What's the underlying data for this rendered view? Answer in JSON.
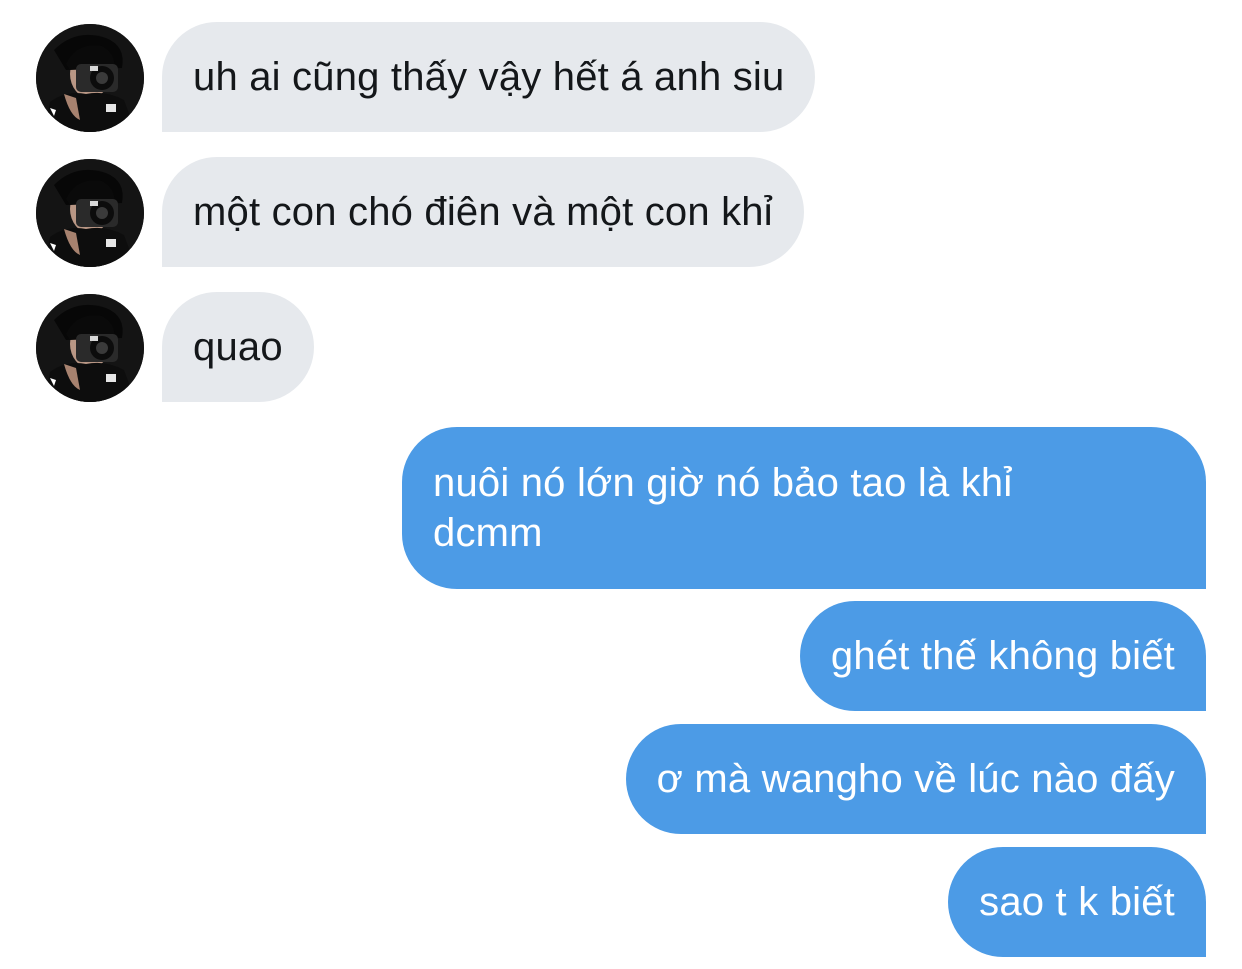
{
  "conversation": {
    "received": [
      {
        "text": "uh ai cũng thấy vậy hết á anh siu"
      },
      {
        "text": "một con chó điên và một con khỉ"
      },
      {
        "text": "quao"
      }
    ],
    "sent": [
      {
        "lines": [
          "nuôi nó lớn giờ nó bảo tao là khỉ",
          "dcmm"
        ]
      },
      {
        "text": "ghét thế không biết"
      },
      {
        "text": "ơ mà wangho về lúc nào đấy"
      },
      {
        "text": "sao t k biết"
      }
    ]
  },
  "colors": {
    "received_bubble": "#e6e9ed",
    "sent_bubble": "#4c9be6",
    "received_text": "#14171a",
    "sent_text": "#ffffff"
  },
  "icons": {
    "avatar": "profile-photo-person-with-camera"
  }
}
